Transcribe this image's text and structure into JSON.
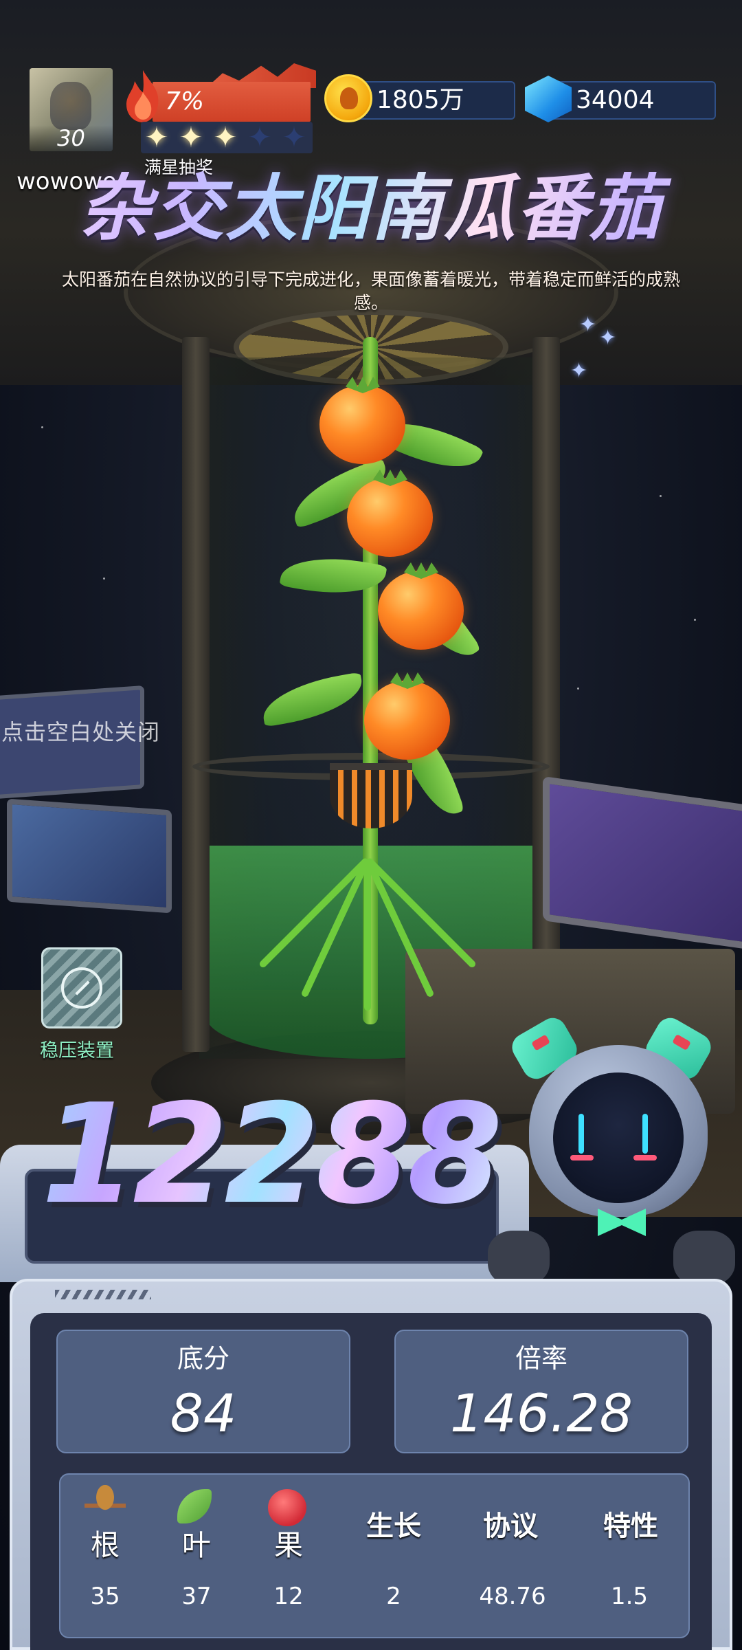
{
  "player": {
    "level": "30",
    "username": "wowowo"
  },
  "heat": {
    "percent_text": "7%",
    "stars_filled": 3,
    "stars_total": 5,
    "full_star_label": "满星抽奖"
  },
  "currency": {
    "coins": "1805万",
    "gems": "34004",
    "coin_icon": "coin-icon",
    "gem_icon": "gem-icon"
  },
  "plant": {
    "name": "杂交太阳南瓜番茄",
    "description": "太阳番茄在自然协议的引导下完成进化，果面像蓄着暖光，带着稳定而鲜活的成熟感。"
  },
  "close_hint": "点击空白处关闭",
  "device": {
    "label": "稳压装置",
    "icon": "compass-icon"
  },
  "score": {
    "total": "12288",
    "base_label": "底分",
    "base_value": "84",
    "multiplier_label": "倍率",
    "multiplier_value": "146.28"
  },
  "attributes": [
    {
      "name": "根",
      "value": "35",
      "icon": "root-icon"
    },
    {
      "name": "叶",
      "value": "37",
      "icon": "leaf-icon"
    },
    {
      "name": "果",
      "value": "12",
      "icon": "apple-icon"
    },
    {
      "name": "生长",
      "value": "2"
    },
    {
      "name": "协议",
      "value": "48.76"
    },
    {
      "name": "特性",
      "value": "1.5"
    }
  ],
  "colors": {
    "heat_bar": "#e25d40",
    "device_label": "#8ef0c4",
    "panel_box": "#4f5f80"
  }
}
